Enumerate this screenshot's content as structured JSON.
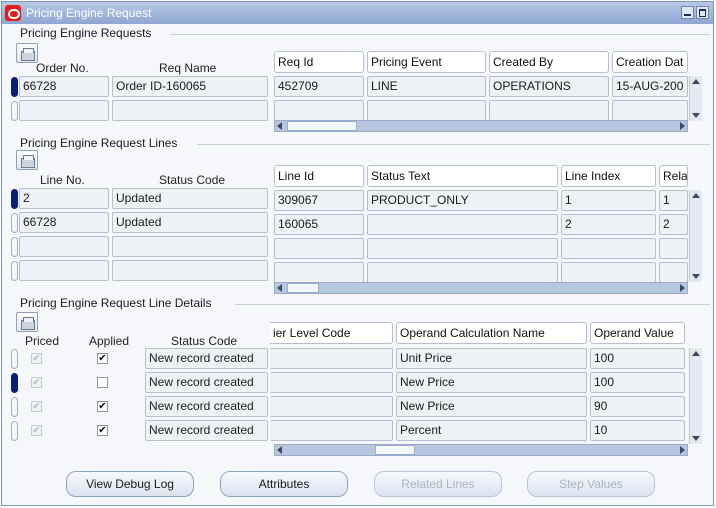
{
  "window": {
    "title": "Pricing Engine Request"
  },
  "requests": {
    "title": "Pricing Engine Requests",
    "label_order_no": "Order No.",
    "label_req_name": "Req Name",
    "columns": [
      "Req Id",
      "Pricing Event",
      "Created By",
      "Creation Dat"
    ],
    "rows": [
      {
        "order_no": "66728",
        "req_name": "Order ID-160065",
        "req_id": "452709",
        "event": "LINE",
        "created_by": "OPERATIONS",
        "creation_date": "15-AUG-200"
      }
    ]
  },
  "lines": {
    "title": "Pricing Engine Request Lines",
    "label_line_no": "Line No.",
    "label_status_code": "Status Code",
    "columns": [
      "Line Id",
      "Status Text",
      "Line Index",
      "Rela"
    ],
    "rows": [
      {
        "line_no": "2",
        "status_code": "Updated",
        "line_id": "309067",
        "status_text": "PRODUCT_ONLY",
        "line_index": "1",
        "rela": "1"
      },
      {
        "line_no": "66728",
        "status_code": "Updated",
        "line_id": "160065",
        "status_text": "",
        "line_index": "2",
        "rela": "2"
      }
    ]
  },
  "details": {
    "title": "Pricing Engine Request Line Details",
    "label_priced": "Priced",
    "label_applied": "Applied",
    "label_status_code": "Status Code",
    "columns": [
      "ier Level Code",
      "Operand Calculation Name",
      "Operand Value"
    ],
    "rows": [
      {
        "priced": true,
        "applied": true,
        "status": "New record created",
        "calc_name": "Unit Price",
        "value": "100"
      },
      {
        "priced": true,
        "applied": false,
        "status": "New record created",
        "calc_name": "New Price",
        "value": "100"
      },
      {
        "priced": true,
        "applied": true,
        "status": "New record created",
        "calc_name": "New Price",
        "value": "90"
      },
      {
        "priced": true,
        "applied": true,
        "status": "New record created",
        "calc_name": "Percent",
        "value": "10"
      }
    ]
  },
  "buttons": {
    "view_debug_log": "View Debug Log",
    "attributes": "Attributes",
    "related_lines": "Related Lines",
    "step_values": "Step Values"
  }
}
